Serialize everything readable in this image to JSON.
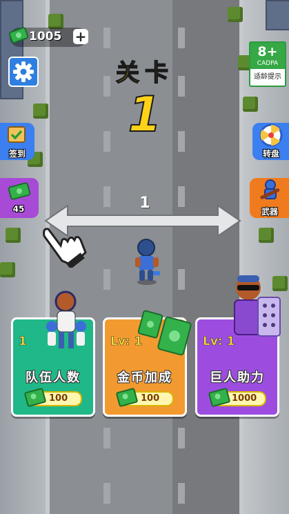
{
  "hud": {
    "coins": "1005",
    "plus_label": "+",
    "age_rating": "8+",
    "age_org": "CADPA",
    "age_tip": "适龄提示"
  },
  "level": {
    "label": "关卡",
    "number": "1"
  },
  "side_buttons": {
    "signin_label": "签到",
    "gift_count": "45",
    "wheel_label": "转盘",
    "weapon_label": "武器"
  },
  "swipe": {
    "number": "1"
  },
  "cards": [
    {
      "level": "1",
      "title": "队伍人数",
      "price": "100"
    },
    {
      "level": "Lv: 1",
      "title": "金币加成",
      "price": "100"
    },
    {
      "level": "Lv: 1",
      "title": "巨人助力",
      "price": "1000"
    }
  ],
  "colors": {
    "level_text": "#ffd21a",
    "card_teal": "#20b888",
    "card_orange": "#f29a30",
    "card_purple": "#9c4de0",
    "age_green": "#36a846"
  },
  "icons": [
    "money-icon",
    "plus-icon",
    "settings-gear-icon",
    "calendar-signin-icon",
    "money-stack-icon",
    "prize-wheel-icon",
    "weapon-icon",
    "swipe-arrow-icon",
    "pointer-hand-icon"
  ]
}
